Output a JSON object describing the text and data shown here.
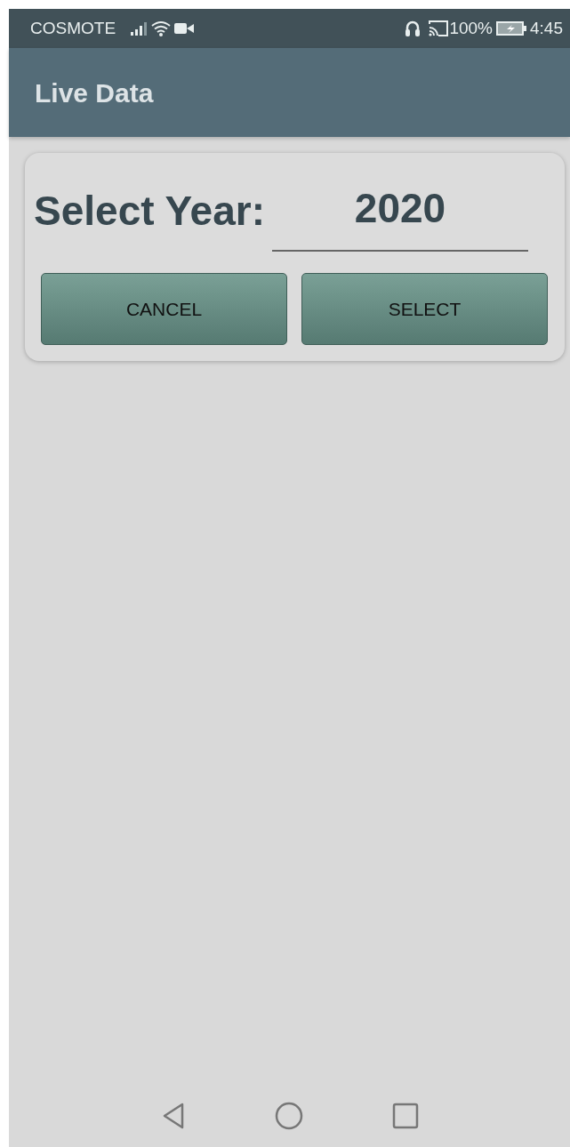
{
  "status_bar": {
    "carrier": "COSMOTE",
    "battery": "100%",
    "time": "4:45"
  },
  "app_bar": {
    "title": "Live Data"
  },
  "dialog": {
    "label": "Select Year:",
    "year": {
      "value": "2020"
    },
    "buttons": [
      "CANCEL",
      "SELECT"
    ]
  }
}
